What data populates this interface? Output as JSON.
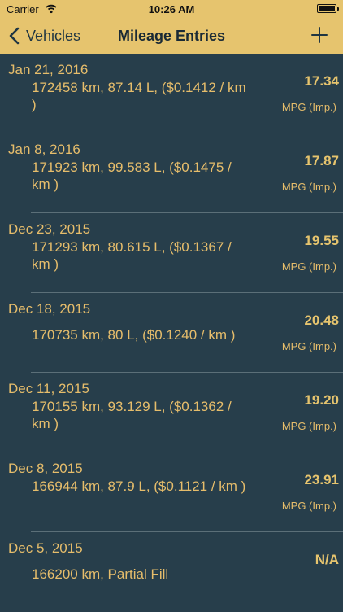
{
  "status_bar": {
    "carrier": "Carrier",
    "time": "10:26 AM"
  },
  "nav": {
    "back_label": "Vehicles",
    "title": "Mileage Entries"
  },
  "entries": [
    {
      "date": "Jan 21, 2016",
      "detail": "172458 km, 87.14 L, ($0.1412 / km )",
      "value": "17.34",
      "unit": "MPG (Imp.)"
    },
    {
      "date": "Jan 8, 2016",
      "detail": "171923 km, 99.583 L, ($0.1475 / km )",
      "value": "17.87",
      "unit": "MPG (Imp.)"
    },
    {
      "date": "Dec 23, 2015",
      "detail": "171293 km, 80.615 L, ($0.1367 / km )",
      "value": "19.55",
      "unit": "MPG (Imp.)"
    },
    {
      "date": "Dec 18, 2015",
      "detail": "170735 km, 80 L, ($0.1240 / km )",
      "value": "20.48",
      "unit": "MPG (Imp.)"
    },
    {
      "date": "Dec 11, 2015",
      "detail": "170155 km, 93.129 L, ($0.1362 / km )",
      "value": "19.20",
      "unit": "MPG (Imp.)"
    },
    {
      "date": "Dec 8, 2015",
      "detail": "166944 km, 87.9 L, ($0.1121 / km )",
      "value": "23.91",
      "unit": "MPG (Imp.)"
    },
    {
      "date": "Dec 5, 2015",
      "detail": "166200 km, Partial Fill",
      "value": "N/A",
      "unit": ""
    }
  ]
}
